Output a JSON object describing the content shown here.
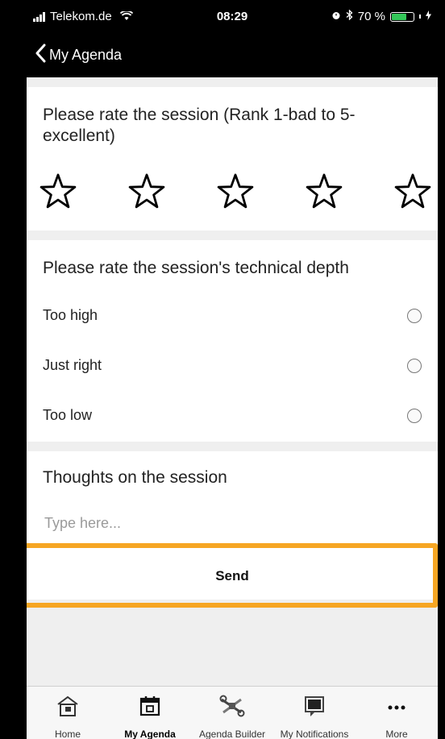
{
  "status_bar": {
    "carrier": "Telekom.de",
    "time": "08:29",
    "battery_percent": "70 %",
    "battery_level": 0.7,
    "icons": [
      "signal-icon",
      "wifi-icon",
      "alarm-icon",
      "bluetooth-icon",
      "battery-icon",
      "charging-icon"
    ]
  },
  "nav": {
    "back_label": "My Agenda"
  },
  "rating": {
    "title": "Please rate the session (Rank 1-bad to 5-excellent)",
    "stars_total": 5,
    "stars_selected": 0
  },
  "depth": {
    "title": "Please rate the session's technical depth",
    "options": [
      {
        "label": "Too high",
        "selected": false
      },
      {
        "label": "Just right",
        "selected": false
      },
      {
        "label": "Too low",
        "selected": false
      }
    ]
  },
  "thoughts": {
    "title": "Thoughts on the session",
    "placeholder": "Type here...",
    "value": ""
  },
  "send_label": "Send",
  "highlight_color": "#f6a623",
  "tabs": [
    {
      "label": "Home",
      "icon": "home-icon",
      "active": false
    },
    {
      "label": "My Agenda",
      "icon": "calendar-icon",
      "active": true
    },
    {
      "label": "Agenda Builder",
      "icon": "tools-icon",
      "active": false
    },
    {
      "label": "My Notifications",
      "icon": "notifications-icon",
      "active": false
    },
    {
      "label": "More",
      "icon": "more-icon",
      "active": false
    }
  ]
}
